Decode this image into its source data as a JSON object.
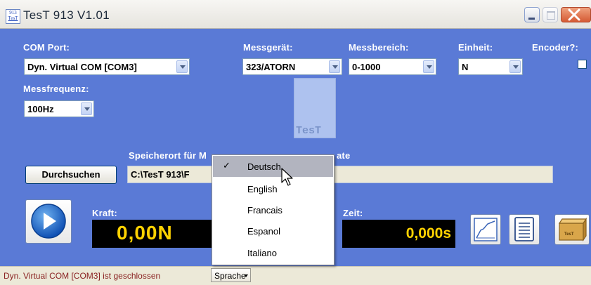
{
  "window": {
    "title": "TesT 913 V1.01",
    "icon_text": [
      "913",
      "TesT"
    ]
  },
  "labels": {
    "com_port": "COM Port:",
    "messgeraet": "Messgerät:",
    "messbereich": "Messbereich:",
    "einheit": "Einheit:",
    "encoder": "Encoder?:",
    "messfrequenz": "Messfrequenz:",
    "speicherort": "Speicherort für M",
    "speicherort_tail": "ate",
    "kraft": "Kraft:",
    "zeit": "Zeit:"
  },
  "selects": {
    "com_port": "Dyn. Virtual COM [COM3]",
    "messgeraet": "323/ATORN",
    "messbereich": "0-1000",
    "einheit": "N",
    "messfrequenz": "100Hz"
  },
  "encoder_checked": false,
  "logo_text": "TesT",
  "browse_button": "Durchsuchen",
  "path_value": "C:\\TesT 913\\F",
  "kraft_value": "0,00N",
  "zeit_value": "0,000s",
  "status_text": "Dyn. Virtual COM [COM3] ist geschlossen",
  "language_button": "Sprache",
  "language_menu": {
    "items": [
      "Deutsch",
      "English",
      "Francais",
      "Espanol",
      "Italiano"
    ],
    "checked": "Deutsch",
    "check_glyph": "✓"
  },
  "box_icon_text": "TesT",
  "icons": [
    "play-icon",
    "chart-icon",
    "document-icon",
    "box-icon",
    "cursor-icon"
  ],
  "colors": {
    "panel": "#5a7ad6",
    "display_bg": "#000000",
    "display_fg": "#ffd200",
    "status_text": "#8a2222"
  }
}
